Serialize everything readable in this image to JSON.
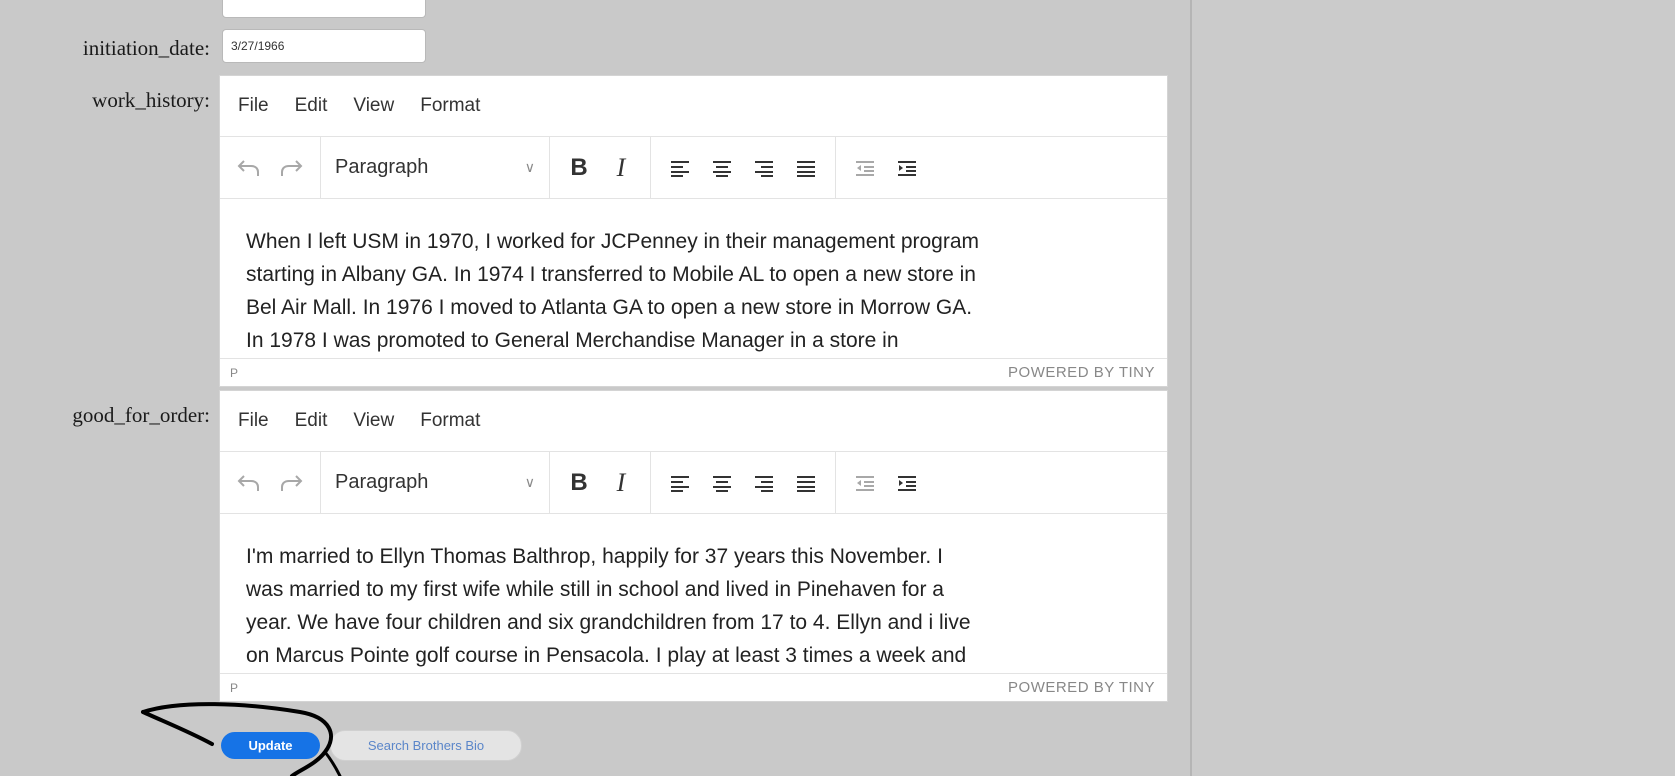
{
  "form": {
    "fields": [
      {
        "label": "initiation_date:",
        "value": "3/27/1966"
      },
      {
        "label": "work_history:"
      },
      {
        "label": "good_for_order:"
      }
    ]
  },
  "editor_ui": {
    "menus": [
      "File",
      "Edit",
      "View",
      "Format"
    ],
    "block_format": "Paragraph",
    "bold_label": "B",
    "italic_label": "I",
    "status_path": "P",
    "branding": "POWERED BY TINY"
  },
  "work_history": {
    "lines": [
      "When I left USM in 1970, I worked for JCPenney in their management program",
      "starting in Albany GA. In 1974 I transferred to Mobile AL to open a new store in",
      "Bel Air Mall. In 1976 I moved to Atlanta GA to open a new store in Morrow GA.",
      "In 1978 I was promoted to General Merchandise Manager in a store in"
    ]
  },
  "good_for_order": {
    "lines": [
      "I'm married to Ellyn Thomas Balthrop, happily for 37 years this November. I",
      "was married to my first wife while still in school and lived in Pinehaven for a",
      "year. We have four children and six grandchildren from 17 to 4. Ellyn and i live",
      "on Marcus Pointe golf course in Pensacola. I play at least 3 times a week and"
    ]
  },
  "buttons": {
    "update": "Update",
    "search": "Search Brothers Bio"
  },
  "colors": {
    "page_bg": "#c9c9c9",
    "primary": "#1673e6",
    "annotation": "#000000"
  },
  "icons": [
    "undo-icon",
    "redo-icon",
    "align-left-icon",
    "align-center-icon",
    "align-right-icon",
    "align-justify-icon",
    "outdent-icon",
    "indent-icon"
  ]
}
